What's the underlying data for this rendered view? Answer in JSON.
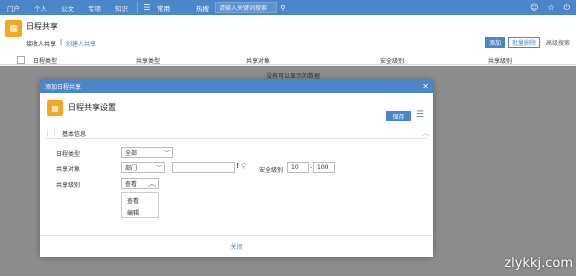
{
  "topbar": {
    "nav": [
      "门户",
      "个人",
      "公文",
      "专项",
      "知识"
    ],
    "common": "常用",
    "hot": "热搜",
    "search_placeholder": "请输入关键词搜索",
    "icons": [
      "menu-icon",
      "search-icon",
      "user-icon",
      "star-icon",
      "power-icon"
    ]
  },
  "header": {
    "title": "日程共享",
    "subnav": [
      "接收人共享",
      "|",
      "创建人共享"
    ],
    "add_label": "添加",
    "batch_delete_label": "批量删除",
    "advanced_search_label": "高级搜索"
  },
  "table": {
    "columns": [
      "日程类型",
      "共享类型",
      "共享对象",
      "安全级别",
      "共享级别"
    ],
    "empty_message": "没有可以显示的数据"
  },
  "modal": {
    "title": "添加日程共享",
    "heading": "日程共享设置",
    "save_label": "保存",
    "section": "基本信息",
    "fields": {
      "schedule_type_label": "日程类型",
      "schedule_type_value": "全部",
      "share_target_label": "共享对象",
      "share_target_type": "部门",
      "security_level_label": "安全级别",
      "security_min": "10",
      "security_dash": "-",
      "security_max": "100",
      "share_level_label": "共享级别",
      "share_level_value": "查看"
    },
    "dropdown_options": [
      "查看",
      "编辑"
    ],
    "close_label": "关闭"
  },
  "watermark": "zlykkj.com",
  "colors": {
    "primary": "#4a86c8",
    "accent": "#f5a623",
    "required": "#e0302a"
  }
}
